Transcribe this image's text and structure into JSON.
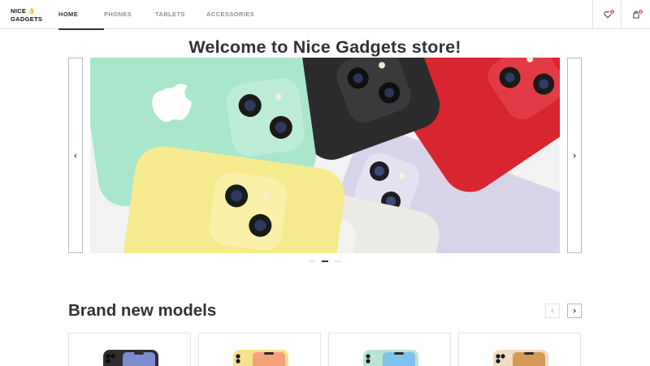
{
  "header": {
    "logo_line1": "NICE",
    "logo_line2": "GADGETS",
    "nav": [
      {
        "label": "HOME",
        "active": true
      },
      {
        "label": "PHONES",
        "active": false
      },
      {
        "label": "TABLETS",
        "active": false
      },
      {
        "label": "ACCESSORIES",
        "active": false
      }
    ],
    "favourites_count": "1",
    "cart_count": "1"
  },
  "main": {
    "title": "Welcome to Nice Gadgets store!",
    "slider": {
      "banner_icon": "iphone-11-colors-banner",
      "dots": 3,
      "active_dot": 1
    }
  },
  "brand_new": {
    "title": "Brand new models",
    "products": [
      {
        "icon": "iphone-black",
        "color": "#2e2e30",
        "screen": "#7d8ccf"
      },
      {
        "icon": "iphone-yellow",
        "color": "#f6e28b",
        "screen": "#f3a27a"
      },
      {
        "icon": "iphone-green",
        "color": "#b9e5d4",
        "screen": "#7fc1ee"
      },
      {
        "icon": "iphone-gold",
        "color": "#f1dcc6",
        "screen": "#d49a58"
      }
    ]
  },
  "colors": {
    "primary": "#313237",
    "secondary": "#89939a",
    "border": "#e2e6e9",
    "badge": "#eb5757"
  }
}
